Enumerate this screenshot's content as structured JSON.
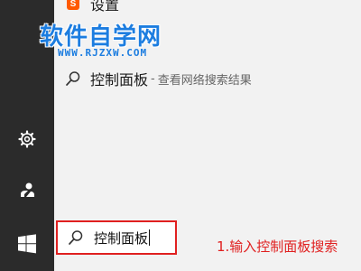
{
  "watermark": {
    "title": "软件自学网",
    "url": "WWW.RJZXW.COM",
    "color": "#1c7de0"
  },
  "results": {
    "top_item": {
      "label": "设置",
      "icon": "sogou-settings-icon"
    },
    "best_match": {
      "label": "控制面板",
      "separator": "-",
      "sub": "查看网络搜索结果",
      "icon": "search-icon"
    }
  },
  "sidebar": {
    "settings_icon": "gear-icon",
    "user_icon": "user-icon",
    "start_icon": "windows-logo-icon"
  },
  "search": {
    "value": "控制面板",
    "highlight_color": "#e02020"
  },
  "annotation": {
    "text": "1.输入控制面板搜索"
  },
  "colors": {
    "taskbar": "#2b2b2b",
    "pane": "#f2f2f2",
    "accent_red": "#e02020"
  }
}
